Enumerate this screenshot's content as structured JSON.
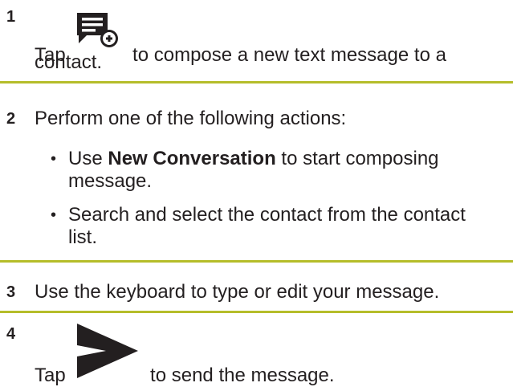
{
  "steps": [
    {
      "number": "1",
      "text_before": "Tap",
      "icon": "compose-message-icon",
      "text_after": "to compose a new text message to a",
      "text_line2": "contact."
    },
    {
      "number": "2",
      "text": "Perform one of the following actions:",
      "bullets": [
        {
          "marker": "•",
          "prefix": "Use",
          "bold": "New Conversation",
          "suffix": "to start composing",
          "line2": "message."
        },
        {
          "marker": "•",
          "text": "Search and select the contact from the contact",
          "line2": "list."
        }
      ]
    },
    {
      "number": "3",
      "text": "Use the keyboard to type or edit your message."
    },
    {
      "number": "4",
      "text_before": "Tap",
      "icon": "send-icon",
      "text_after": "to send the message."
    }
  ],
  "colors": {
    "divider": "#b5bd2a",
    "text": "#231f20",
    "icon": "#231f20"
  }
}
